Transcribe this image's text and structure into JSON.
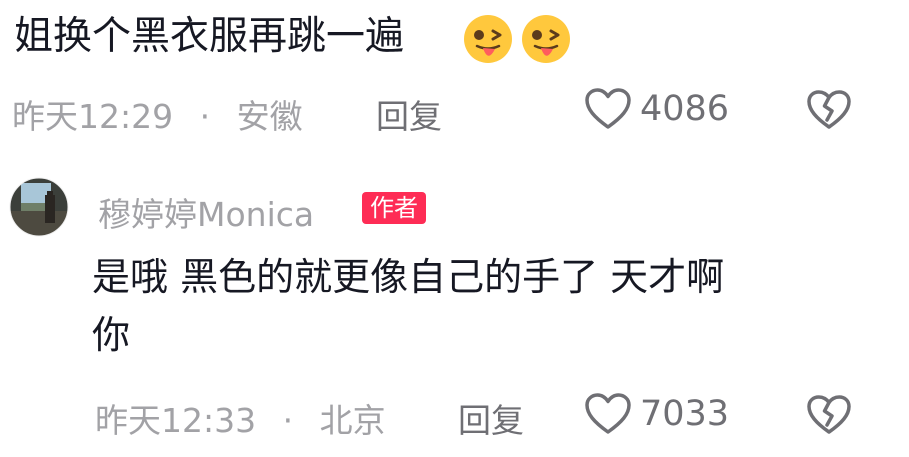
{
  "comment": {
    "text": "姐换个黑衣服再跳一遍",
    "emojis": [
      "tongue-wink-emoji",
      "tongue-wink-emoji"
    ],
    "time": "昨天12:29",
    "dot": "·",
    "location": "安徽",
    "reply_label": "回复",
    "likes": "4086",
    "like_icon": "heart-outline-icon",
    "dislike_icon": "broken-heart-icon"
  },
  "reply": {
    "author": "穆婷婷Monica",
    "author_badge": "作者",
    "text_line1": "是哦 黑色的就更像自己的手了 天才啊",
    "text_line2": "你",
    "time": "昨天12:33",
    "dot": "·",
    "location": "北京",
    "reply_label": "回复",
    "likes": "7033",
    "like_icon": "heart-outline-icon",
    "dislike_icon": "broken-heart-icon"
  },
  "colors": {
    "text": "#161823",
    "meta": "#a2a2a6",
    "badge": "#fe2c55",
    "emoji": "#ffc83d"
  }
}
